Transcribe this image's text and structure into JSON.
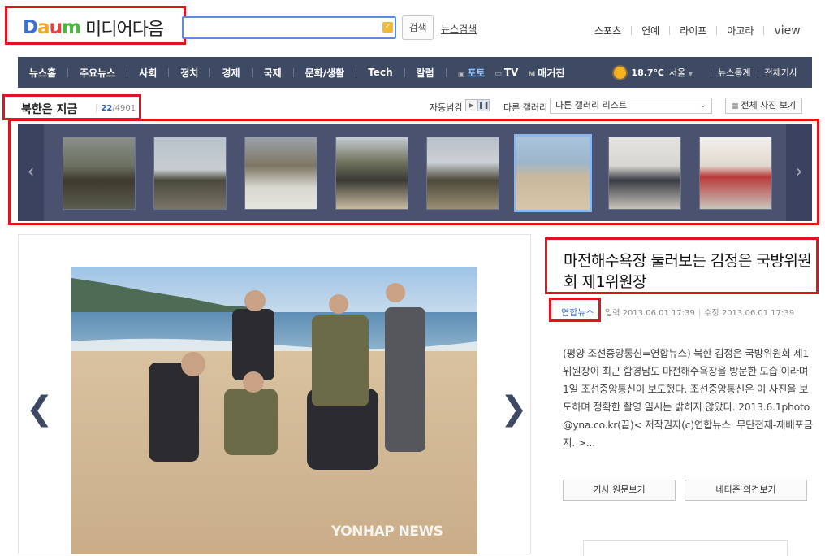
{
  "header": {
    "logo_daum": "Daum",
    "logo_text": "미디어다음",
    "search_placeholder": "",
    "search_button": "검색",
    "news_search_link": "뉴스검색",
    "top_nav": [
      "스포츠",
      "연예",
      "라이프",
      "아고라",
      "view"
    ]
  },
  "gnb": {
    "items": [
      "뉴스홈",
      "주요뉴스",
      "사회",
      "정치",
      "경제",
      "국제",
      "문화/생활",
      "Tech",
      "칼럼"
    ],
    "media_items": [
      {
        "icon": "photo-icon",
        "label": "포토"
      },
      {
        "icon": "tv-icon",
        "label": "TV"
      },
      {
        "icon": "magazine-icon",
        "label": "매거진"
      }
    ],
    "weather_temp": "18.7℃",
    "weather_city": "서울",
    "right_links": [
      "뉴스통계",
      "전체기사"
    ]
  },
  "gallery": {
    "title": "북한은 지금",
    "current": "22",
    "total": "/4901",
    "autoplay_label": "자동넘김",
    "other_gallery_label": "다른 갤러리",
    "other_gallery_value": "다른 갤러리 리스트",
    "all_photos_button": "전체 사진 보기",
    "selected_thumb_index": 5
  },
  "article": {
    "title": "마전해수욕장 둘러보는 김정은 국방위원회 제1위원장",
    "source": "연합뉴스",
    "input_label": "입력",
    "input_date": "2013.06.01 17:39",
    "edit_label": "수정",
    "edit_date": "2013.06.01 17:39",
    "body": "(평양 조선중앙통신=연합뉴스) 북한 김정은 국방위원회 제1위원장이 최근 함경남도 마전해수욕장을 방문한 모습 이라며 1일 조선중앙통신이 보도했다. 조선중앙통신은 이 사진을 보도하며 정확한 촬영 일시는 밝히지 않았다. 2013.6.1photo@yna.co.kr(끝)< 저작권자(c)연합뉴스. 무단전재-재배포금지. >...",
    "original_button": "기사 원문보기",
    "comments_button": "네티즌 의견보기",
    "watermark": "YONHAP NEWS"
  },
  "colors": {
    "gnb_bg": "#3e4a63",
    "highlight": "#e0141e",
    "link": "#3b6fd6"
  }
}
